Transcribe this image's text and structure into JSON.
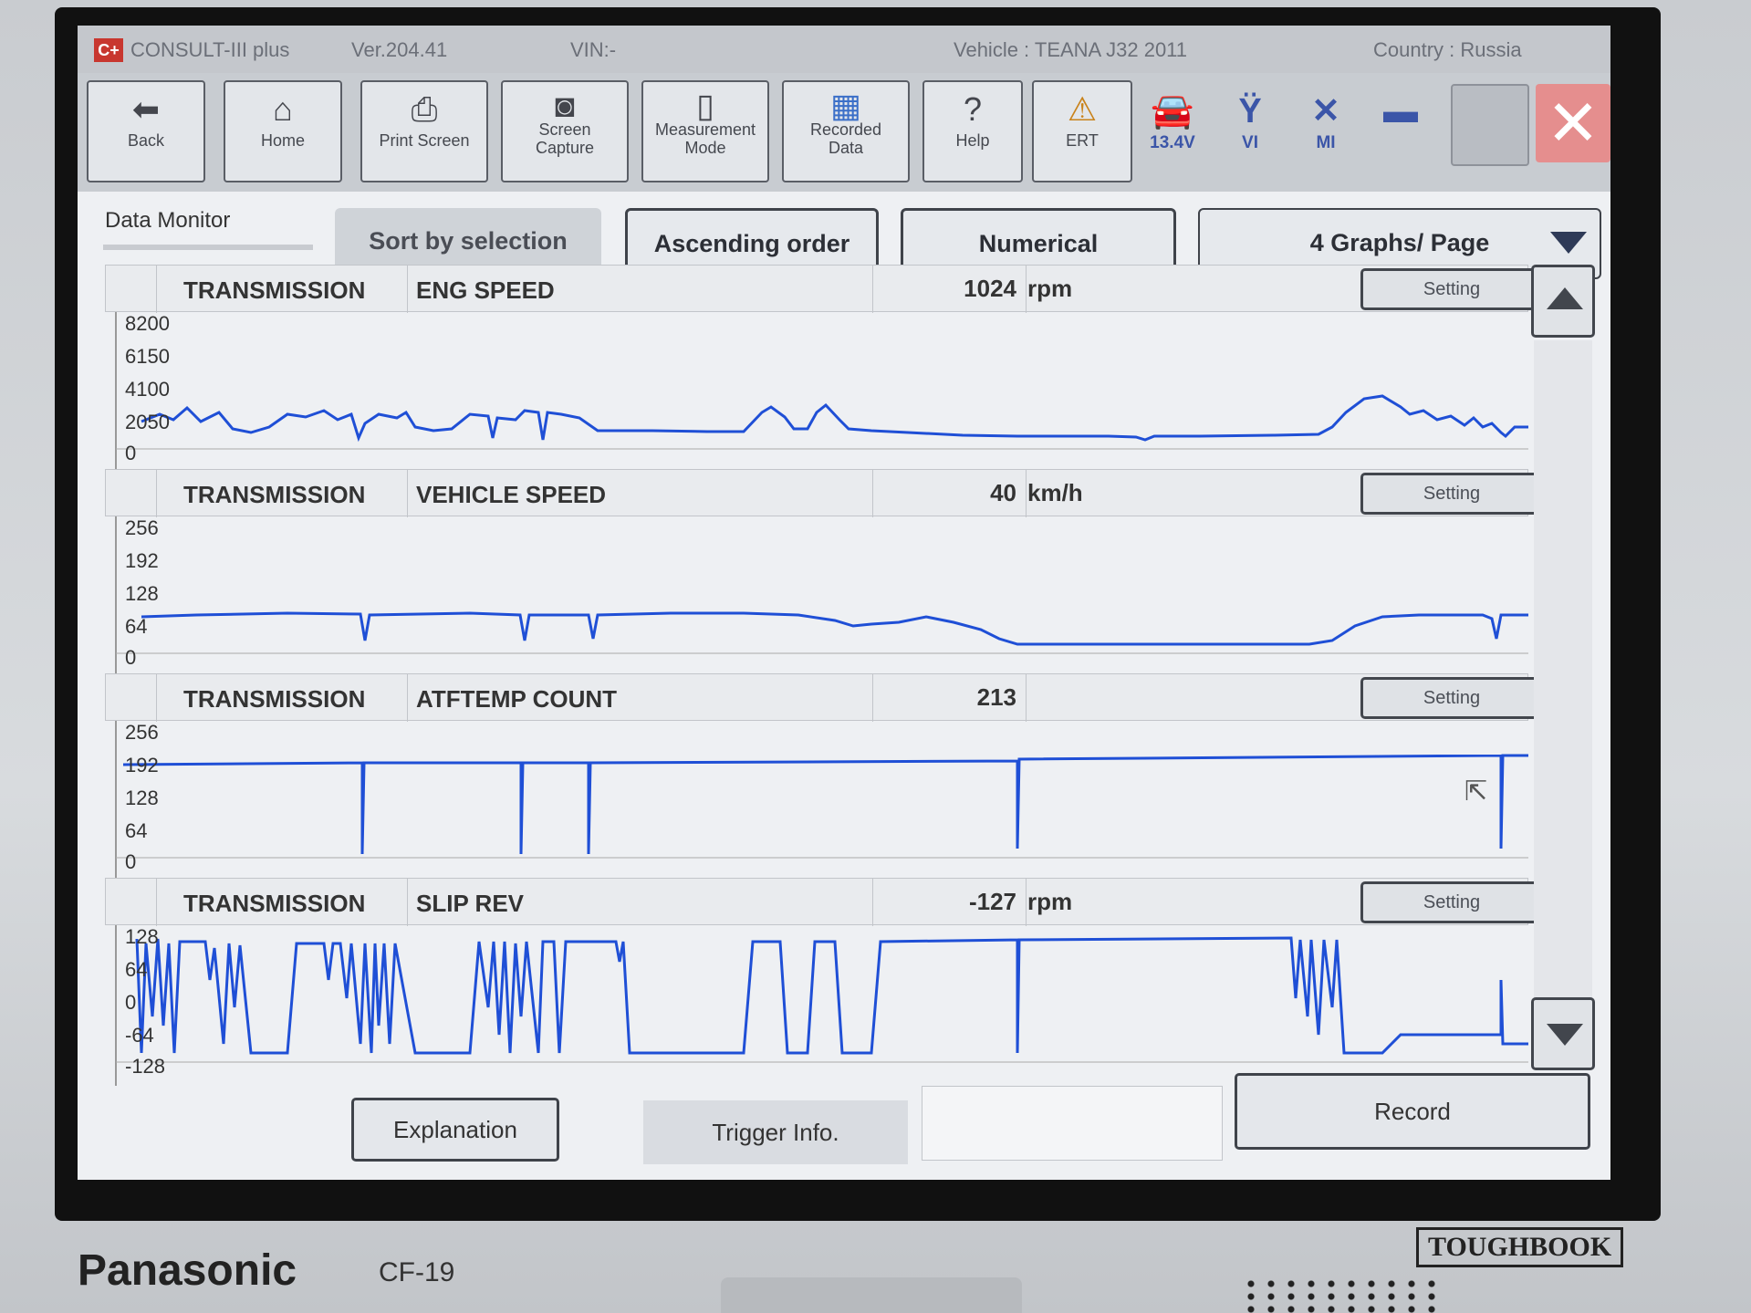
{
  "titlebar": {
    "logo": "C+",
    "app": "CONSULT-III plus",
    "version": "Ver.204.41",
    "vin": "VIN:-",
    "vehicle": "Vehicle : TEANA J32 2011",
    "country": "Country : Russia"
  },
  "toolbar": {
    "back": "Back",
    "home": "Home",
    "print": "Print Screen",
    "capture": "Screen Capture",
    "measure": "Measurement Mode",
    "recorded": "Recorded Data",
    "help": "Help",
    "ert": "ERT",
    "battery": "13.4V",
    "vi": "VI",
    "mi": "MI"
  },
  "options": {
    "title": "Data Monitor",
    "sort": "Sort by selection",
    "order": "Ascending order",
    "numerical": "Numerical",
    "graphs": "4 Graphs/ Page"
  },
  "panels": [
    {
      "group": "TRANSMISSION",
      "name": "ENG SPEED",
      "value": "1024",
      "unit": "rpm",
      "setting": "Setting",
      "ticks": [
        "8200",
        "6150",
        "4100",
        "2050",
        "0"
      ]
    },
    {
      "group": "TRANSMISSION",
      "name": "VEHICLE SPEED",
      "value": "40",
      "unit": "km/h",
      "setting": "Setting",
      "ticks": [
        "256",
        "192",
        "128",
        "64",
        "0"
      ]
    },
    {
      "group": "TRANSMISSION",
      "name": "ATFTEMP COUNT",
      "value": "213",
      "unit": "",
      "setting": "Setting",
      "ticks": [
        "256",
        "192",
        "128",
        "64",
        "0"
      ]
    },
    {
      "group": "TRANSMISSION",
      "name": "SLIP REV",
      "value": "-127",
      "unit": "rpm",
      "setting": "Setting",
      "ticks": [
        "128",
        "64",
        "0",
        "-64",
        "-128"
      ]
    }
  ],
  "bottom": {
    "explanation": "Explanation",
    "trigger": "Trigger Info.",
    "record": "Record"
  },
  "device": {
    "brand": "Panasonic",
    "model": "CF-19",
    "series": "TOUGHBOOK"
  },
  "colors": {
    "trace": "#1f4fd6",
    "close": "#e58e8e",
    "status": "#3b55a8"
  }
}
